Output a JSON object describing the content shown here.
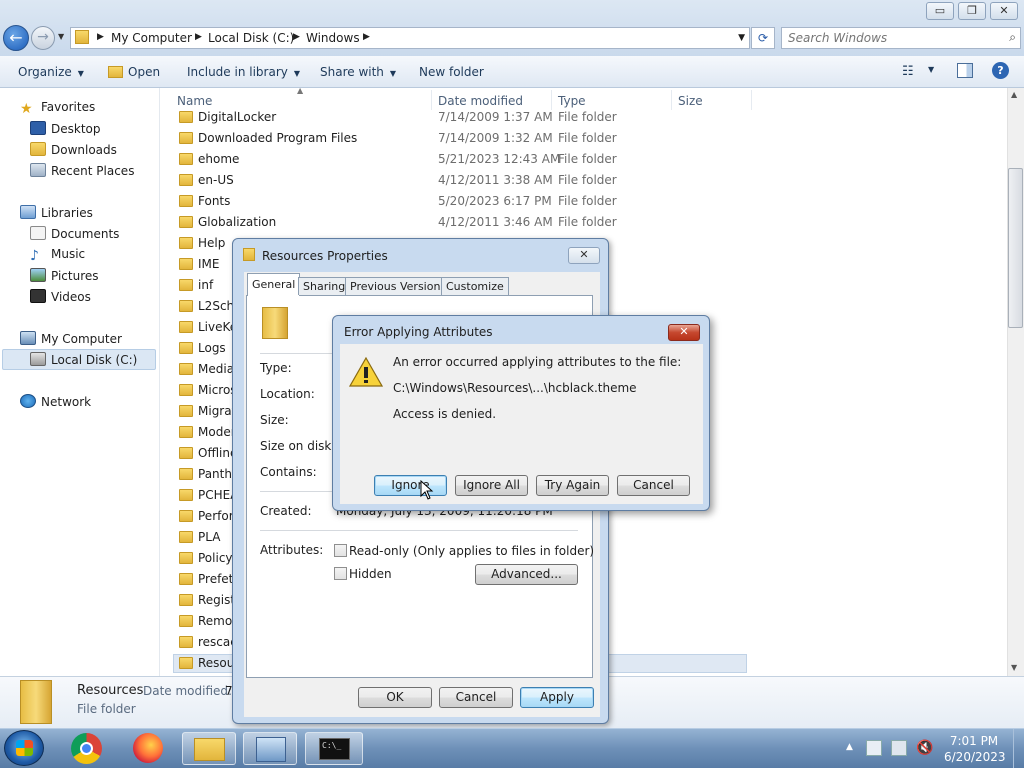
{
  "window": {
    "controls": {
      "minimize": "▭",
      "maximize": "❐",
      "close": "✕"
    }
  },
  "address": {
    "crumbs": [
      "My Computer",
      "Local Disk (C:)",
      "Windows"
    ],
    "search_placeholder": "Search Windows"
  },
  "toolbar": {
    "organize": "Organize",
    "open": "Open",
    "include_in_library": "Include in library",
    "share_with": "Share with",
    "new_folder": "New folder"
  },
  "sidebar": {
    "favorites": "Favorites",
    "desktop": "Desktop",
    "downloads": "Downloads",
    "recent_places": "Recent Places",
    "libraries": "Libraries",
    "documents": "Documents",
    "music": "Music",
    "pictures": "Pictures",
    "videos": "Videos",
    "my_computer": "My Computer",
    "local_disk": "Local Disk (C:)",
    "network": "Network"
  },
  "filelist": {
    "columns": {
      "name": "Name",
      "date": "Date modified",
      "type": "Type",
      "size": "Size"
    },
    "rows": [
      {
        "name": "DigitalLocker",
        "date": "7/14/2009 1:37 AM",
        "type": "File folder"
      },
      {
        "name": "Downloaded Program Files",
        "date": "7/14/2009 1:32 AM",
        "type": "File folder"
      },
      {
        "name": "ehome",
        "date": "5/21/2023 12:43 AM",
        "type": "File folder"
      },
      {
        "name": "en-US",
        "date": "4/12/2011 3:38 AM",
        "type": "File folder"
      },
      {
        "name": "Fonts",
        "date": "5/20/2023 6:17 PM",
        "type": "File folder"
      },
      {
        "name": "Globalization",
        "date": "4/12/2011 3:46 AM",
        "type": "File folder"
      },
      {
        "name": "Help"
      },
      {
        "name": "IME"
      },
      {
        "name": "inf"
      },
      {
        "name": "L2Sche"
      },
      {
        "name": "LiveKe"
      },
      {
        "name": "Logs"
      },
      {
        "name": "Media"
      },
      {
        "name": "Micros"
      },
      {
        "name": "Migrat"
      },
      {
        "name": "Moder"
      },
      {
        "name": "Offline"
      },
      {
        "name": "Panthe"
      },
      {
        "name": "PCHEA"
      },
      {
        "name": "Perfor"
      },
      {
        "name": "PLA"
      },
      {
        "name": "Policyl"
      },
      {
        "name": "Prefetc"
      },
      {
        "name": "Registr"
      },
      {
        "name": "Remot"
      },
      {
        "name": "rescac"
      },
      {
        "name": "Resour"
      }
    ]
  },
  "details": {
    "name": "Resources",
    "date_label": "Date modified:",
    "date_value": "7",
    "type": "File folder"
  },
  "properties": {
    "title": "Resources Properties",
    "tabs": [
      "General",
      "Sharing",
      "Previous Versions",
      "Customize"
    ],
    "labels": {
      "type": "Type:",
      "location": "Location:",
      "size": "Size:",
      "size_on_disk": "Size on disk:",
      "contains": "Contains:",
      "created": "Created:",
      "attributes": "Attributes:"
    },
    "created_value": "Monday, July 13, 2009, 11:20:18 PM",
    "readonly_label": "Read-only (Only applies to files in folder)",
    "hidden_label": "Hidden",
    "advanced_button": "Advanced...",
    "ok_button": "OK",
    "cancel_button": "Cancel",
    "apply_button": "Apply"
  },
  "error_dialog": {
    "title": "Error Applying Attributes",
    "message": "An error occurred applying attributes to the file:",
    "path": "C:\\Windows\\Resources\\...\\hcblack.theme",
    "detail": "Access is denied.",
    "buttons": {
      "ignore": "Ignore",
      "ignore_all": "Ignore All",
      "try_again": "Try Again",
      "cancel": "Cancel"
    }
  },
  "taskbar": {
    "time": "7:01 PM",
    "date": "6/20/2023",
    "cmd_label": "C:\\_"
  }
}
